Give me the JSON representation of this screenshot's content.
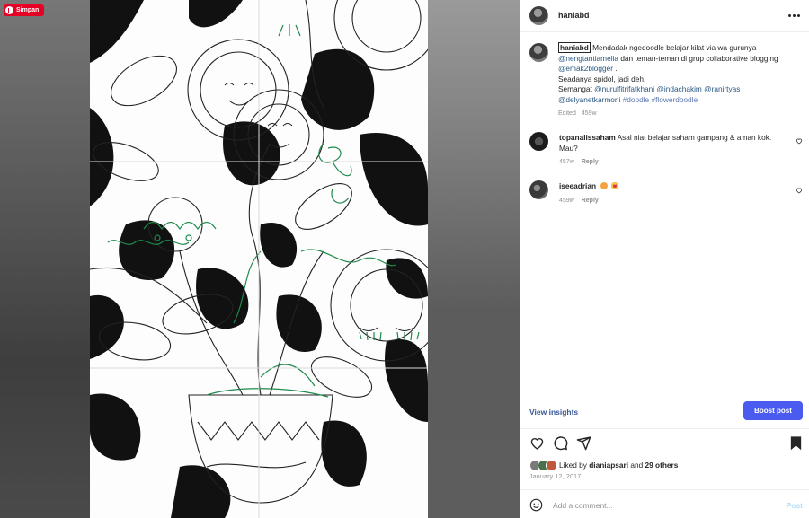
{
  "media": {
    "save_button_label": "Simpan"
  },
  "header": {
    "username": "haniabd"
  },
  "caption": {
    "username": "haniabd",
    "text_1": " Mendadak ngedoodle belajar kilat via wa gurunya ",
    "mention_1": "@nengtantiamelia",
    "text_2": " dan teman-teman di grup collaborative blogging ",
    "mention_2": "@emak2blogger",
    "text_3": " .",
    "line_2": "Seadanya spidol, jadi deh.",
    "text_4": "Semangat ",
    "mention_3": "@nurulfitrifatkhani",
    "mention_4": "@indachakim",
    "mention_5": "@ranirtyas",
    "mention_6": "@delyanetkarmoni",
    "hashtag_1": "#doodle",
    "hashtag_2": "#flowerdoodle",
    "edited": "Edited",
    "time": "459w"
  },
  "comments": [
    {
      "username": "topanalissaham",
      "text": "Asal niat belajar saham gampang & aman kok. Mau?",
      "time": "457w",
      "reply": "Reply"
    },
    {
      "username": "iseeadrian",
      "text": "",
      "time": "459w",
      "reply": "Reply",
      "emojis": [
        "cat-heart-eyes-emoji",
        "heart-eyes-emoji"
      ]
    }
  ],
  "insights": {
    "view_label": "View insights",
    "boost_label": "Boost post"
  },
  "likes": {
    "prefix": "Liked by",
    "user": "dianiapsari",
    "middle": "and",
    "others": "29 others"
  },
  "date": "January 12, 2017",
  "add_comment": {
    "placeholder": "Add a comment...",
    "post_label": "Post"
  },
  "colors": {
    "accent_link": "#00376b",
    "boost_button": "#4a5cf0",
    "pinterest_red": "#e60023"
  }
}
